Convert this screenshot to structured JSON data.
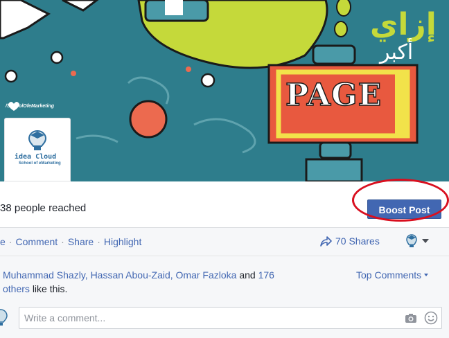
{
  "cover": {
    "arabic_line1": "إزاي",
    "arabic_line2": "أكبر",
    "page_label": "PAGE",
    "fb_handle": "/SchoolOfeMarketing",
    "logo_line1": "idea Cloud",
    "logo_line2": "School of eMarketing",
    "colors": {
      "background": "#2e7d8c",
      "accent_lime": "#c5d93a",
      "accent_orange": "#ec6a4f",
      "sign_red": "#e8593f",
      "sign_yellow": "#f2e24a"
    }
  },
  "post": {
    "reach_text": "38 people reached",
    "boost_button": "Boost Post",
    "actions": [
      {
        "label": "e"
      },
      {
        "label": "Comment"
      },
      {
        "label": "Share"
      },
      {
        "label": "Highlight"
      }
    ],
    "shares_label": "70 Shares",
    "likes": {
      "names": "Muhammad Shazly, Hassan Abou-Zaid, Omar Fazloka",
      "and_word": "and",
      "others_count": "176",
      "others_word": "others",
      "tail": "like this."
    },
    "top_comments_label": "Top Comments",
    "comment_placeholder": "Write a comment...",
    "colors": {
      "link": "#4267b2",
      "boost_bg": "#4267b2",
      "highlight_circle": "#d90f1f"
    }
  }
}
